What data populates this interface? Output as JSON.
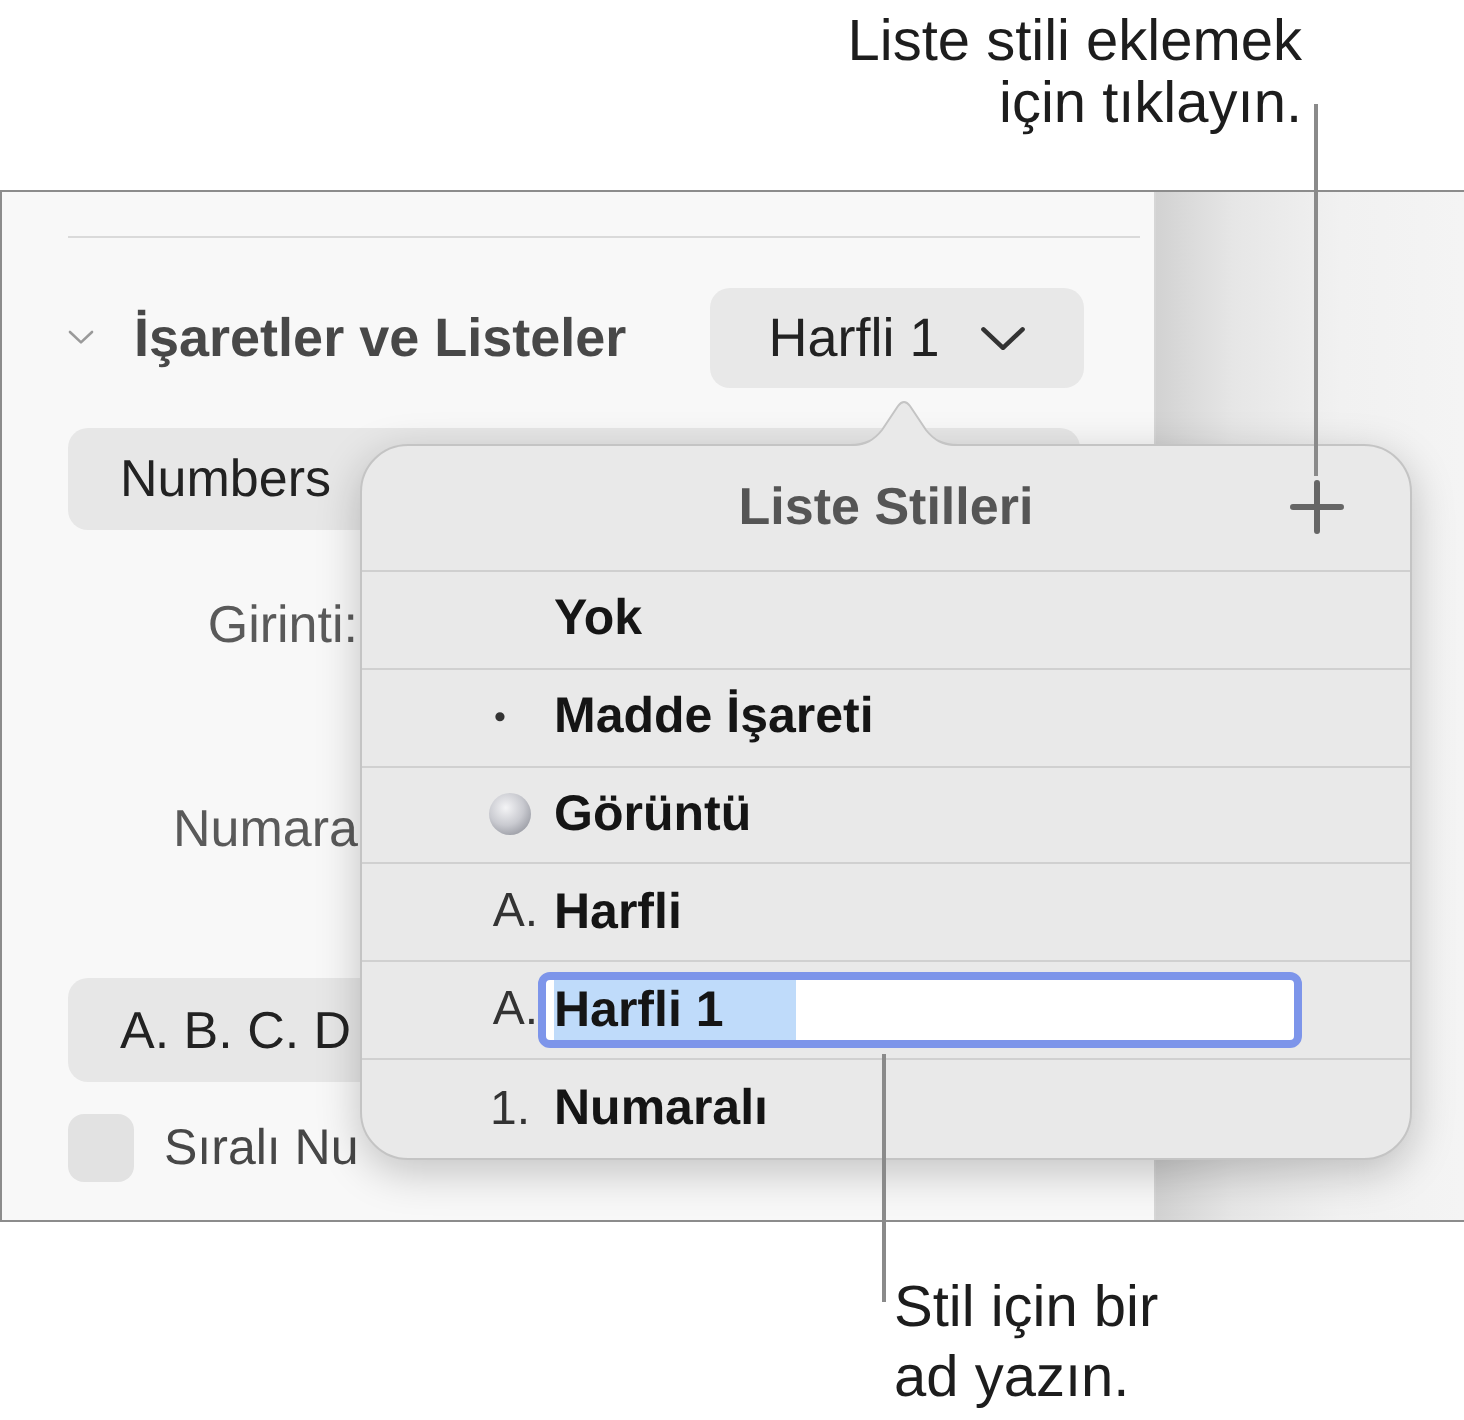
{
  "top_callout": {
    "text": "Liste stili eklemek\niçin tıklayın."
  },
  "sidebar": {
    "section": {
      "title": "İşaretler ve Listeler",
      "expanded": true,
      "style_button": "Harfli 1"
    },
    "font_dropdown": "Numbers",
    "indent_label": "Girinti:",
    "number_label": "Numara",
    "format_field": "A. B. C. D",
    "checkbox": {
      "label": "Sıralı Nu",
      "checked": false
    }
  },
  "popover": {
    "title": "Liste Stilleri",
    "rows": [
      {
        "kind": "none",
        "label": "Yok",
        "editing": false
      },
      {
        "kind": "bullet",
        "marker": "•",
        "label": "Madde İşareti",
        "editing": false
      },
      {
        "kind": "image",
        "label": "Görüntü",
        "editing": false
      },
      {
        "kind": "letter",
        "marker": "A.",
        "label": "Harfli",
        "editing": false
      },
      {
        "kind": "letter",
        "marker": "A.",
        "label": "Harfli 1",
        "editing": true
      },
      {
        "kind": "number",
        "marker": "1.",
        "label": "Numaralı",
        "editing": false
      }
    ]
  },
  "bottom_callout": {
    "text": "Stil için bir\nad yazın."
  }
}
